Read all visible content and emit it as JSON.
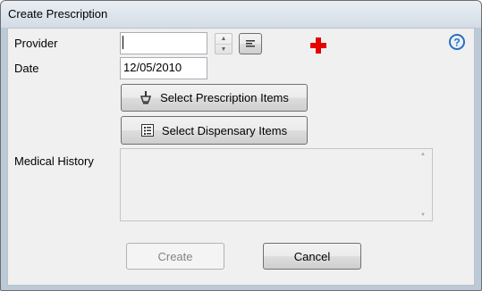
{
  "window": {
    "title": "Create Prescription"
  },
  "form": {
    "provider_label": "Provider",
    "provider_value": "",
    "date_label": "Date",
    "date_value": "12/05/2010",
    "medical_history_label": "Medical History",
    "medical_history_value": ""
  },
  "buttons": {
    "select_prescription": "Select Prescription Items",
    "select_dispensary": "Select Dispensary Items",
    "create": "Create",
    "cancel": "Cancel"
  },
  "icons": {
    "spin_up": "spin-up-arrow",
    "spin_down": "spin-down-arrow",
    "lookup": "lines-icon",
    "medical": "red-cross-icon",
    "help": "help-icon",
    "prescription": "mortar-pestle-icon",
    "dispensary": "list-icon"
  },
  "colors": {
    "red_cross": "#e60000",
    "help": "#2a6ebb"
  }
}
